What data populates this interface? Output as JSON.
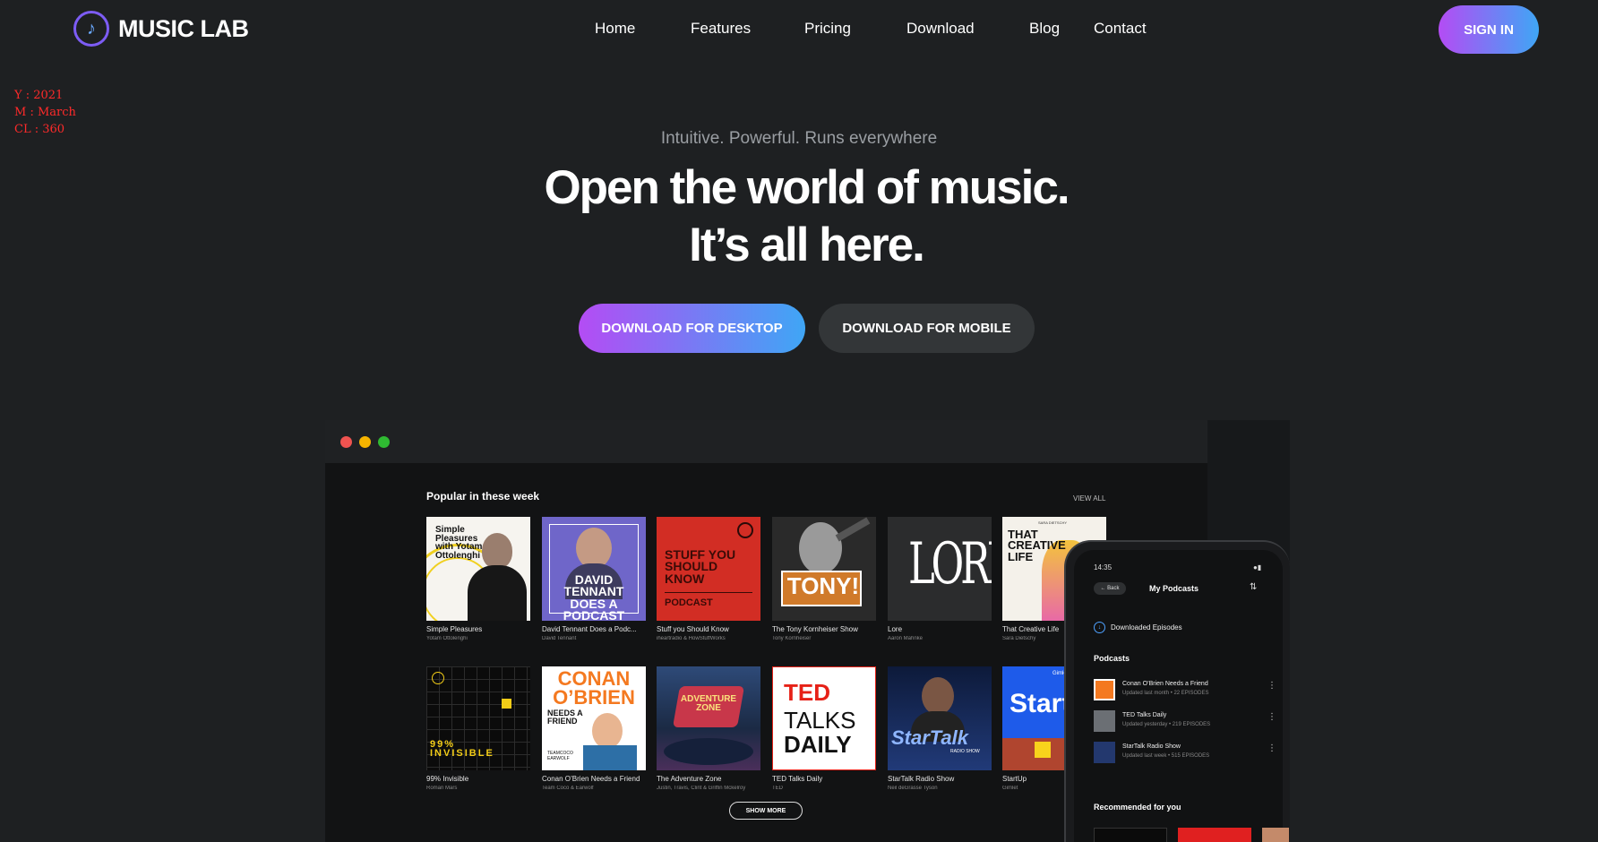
{
  "brand": {
    "name": "MUSIC LAB",
    "icon": "music-note-icon",
    "accent": "#b44cf4",
    "accent2": "#3fa6f5"
  },
  "nav": {
    "links": [
      "Home",
      "Features",
      "Pricing",
      "Download",
      "Blog",
      "Contact"
    ],
    "signin": "SIGN IN"
  },
  "annotation": {
    "year": "Y : 2021",
    "month": "M : March",
    "cl": "CL : 360"
  },
  "hero": {
    "subtitle": "Intuitive. Powerful. Runs everywhere",
    "title_line1": "Open the world of music.",
    "title_line2": "It’s all here.",
    "btn_desktop": "DOWNLOAD FOR DESKTOP",
    "btn_mobile": "DOWNLOAD FOR MOBILE"
  },
  "app": {
    "section_title": "Popular in these week",
    "view_all": "VIEW ALL",
    "show_more": "SHOW MORE",
    "cards": [
      {
        "title": "Simple Pleasures",
        "author": "Yotam Ottolenghi",
        "cover_text": "Simple Pleasures with Yotam Ottolenghi"
      },
      {
        "title": "David Tennant Does a Podc...",
        "author": "David Tennant",
        "cover_text": "DAVID TENNANT DOES A PODCAST WITH..."
      },
      {
        "title": "Stuff you Should Know",
        "author": "iheartradio & HowStuffWorks",
        "cover_text": "STUFF YOU SHOULD KNOW",
        "cover_text2": "PODCAST"
      },
      {
        "title": "The Tony Kornheiser Show",
        "author": "Tony Kornheiser",
        "cover_text": "TONY!"
      },
      {
        "title": "Lore",
        "author": "Aaron Mahnke",
        "cover_text": "LORE"
      },
      {
        "title": "That Creative Life",
        "author": "Sara Dietschy",
        "cover_text": "THAT CREATIVE LIFE",
        "cover_text2": "SARA DIETSCHY"
      },
      {
        "title": "99% Invisible",
        "author": "Roman Mars",
        "cover_text": "99% INVISIBLE"
      },
      {
        "title": "Conan O’Brien Needs a Friend",
        "author": "Team Coco & Earwolf",
        "cover_text": "CONAN O’BRIEN",
        "cover_text2": "NEEDS A FRIEND",
        "cover_text3": "TEAMCOCO EARWOLF"
      },
      {
        "title": "The Adventure Zone",
        "author": "Justin, Travis, Clint & Griffin Mckelroy",
        "cover_text": "ADVENTURE ZONE"
      },
      {
        "title": "TED Talks Daily",
        "author": "TED",
        "cover_text": "TED",
        "cover_text2": "TALKS",
        "cover_text3": "DAILY"
      },
      {
        "title": "StarTalk Radio Show",
        "author": "Neil deGrasse Tyson",
        "cover_text": "StarTalk",
        "cover_text2": "RADIO SHOW"
      },
      {
        "title": "StartUp",
        "author": "Gimlet",
        "cover_text": "StartUp",
        "cover_text2": "Gimlet"
      }
    ]
  },
  "phone": {
    "time": "14:35",
    "back": "Back",
    "title": "My Podcasts",
    "downloaded": "Downloaded Episodes",
    "podcasts_heading": "Podcasts",
    "podcasts": [
      {
        "name": "Conan O’Brien Needs a Friend",
        "meta": "Updated last month • 22 EPISODES"
      },
      {
        "name": "TED Talks Daily",
        "meta": "Updated yesterday • 219 EPISODES"
      },
      {
        "name": "StarTalk Radio Show",
        "meta": "Updated last week • 515 EPISODES"
      }
    ],
    "recommended": "Recommended for you"
  }
}
